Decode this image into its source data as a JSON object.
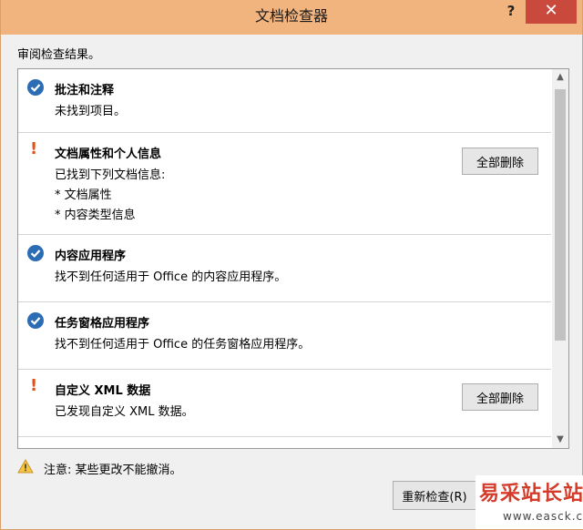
{
  "window": {
    "title": "文档检查器",
    "help_label": "?",
    "close_label": "✕"
  },
  "subtitle": "审阅检查结果。",
  "items": [
    {
      "status": "ok",
      "title": "批注和注释",
      "lines": [
        "未找到项目。"
      ]
    },
    {
      "status": "warning",
      "warn_mark": "!",
      "title": "文档属性和个人信息",
      "lines": [
        "已找到下列文档信息:",
        "* 文档属性",
        "* 内容类型信息"
      ],
      "button_label": "全部删除"
    },
    {
      "status": "ok",
      "title": "内容应用程序",
      "lines": [
        "找不到任何适用于 Office 的内容应用程序。"
      ]
    },
    {
      "status": "ok",
      "title": "任务窗格应用程序",
      "lines": [
        "找不到任何适用于 Office 的任务窗格应用程序。"
      ]
    },
    {
      "status": "warning",
      "warn_mark": "!",
      "title": "自定义 XML 数据",
      "lines": [
        "已发现自定义 XML 数据。"
      ],
      "button_label": "全部删除"
    }
  ],
  "notice": "注意: 某些更改不能撤消。",
  "recheck_label": "重新检查(R)",
  "watermark": {
    "main": "易采站长站",
    "sub": "www.easck.com"
  },
  "colors": {
    "titlebar": "#f2b47e",
    "close": "#c94a3c",
    "ok_icon": "#2b6cb5",
    "warning_mark": "#d9541e"
  }
}
